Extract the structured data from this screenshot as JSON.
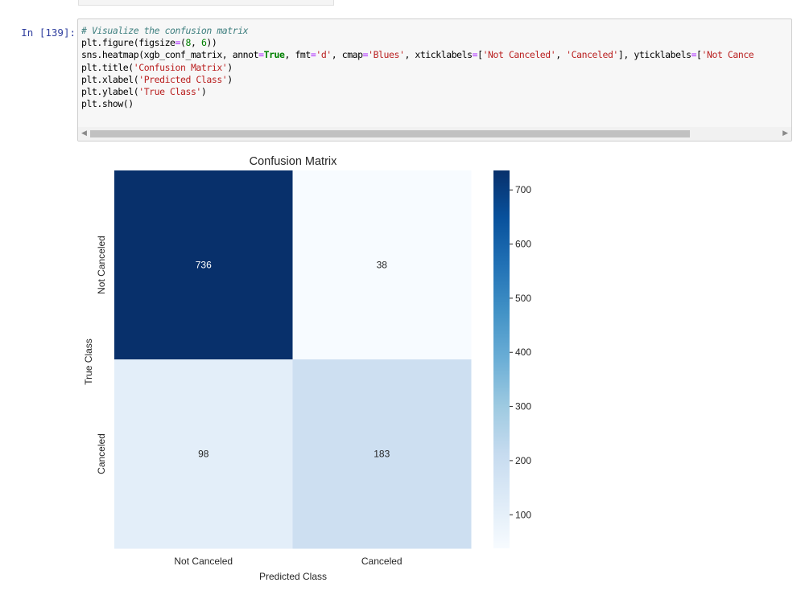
{
  "cell": {
    "prompt": "In [139]:",
    "code_lines": [
      [
        {
          "t": "# Visualize the confusion matrix",
          "c": "cm"
        }
      ],
      [
        {
          "t": "plt.figure(figsize"
        },
        {
          "t": "=",
          "c": "op"
        },
        {
          "t": "("
        },
        {
          "t": "8",
          "c": "nu"
        },
        {
          "t": ", "
        },
        {
          "t": "6",
          "c": "nu"
        },
        {
          "t": "))"
        }
      ],
      [
        {
          "t": "sns.heatmap(xgb_conf_matrix, annot"
        },
        {
          "t": "=",
          "c": "op"
        },
        {
          "t": "True",
          "c": "kw"
        },
        {
          "t": ", fmt"
        },
        {
          "t": "=",
          "c": "op"
        },
        {
          "t": "'d'",
          "c": "st"
        },
        {
          "t": ", cmap"
        },
        {
          "t": "=",
          "c": "op"
        },
        {
          "t": "'Blues'",
          "c": "st"
        },
        {
          "t": ", xticklabels"
        },
        {
          "t": "=",
          "c": "op"
        },
        {
          "t": "["
        },
        {
          "t": "'Not Canceled'",
          "c": "st"
        },
        {
          "t": ", "
        },
        {
          "t": "'Canceled'",
          "c": "st"
        },
        {
          "t": "], yticklabels"
        },
        {
          "t": "=",
          "c": "op"
        },
        {
          "t": "["
        },
        {
          "t": "'Not Cance",
          "c": "st"
        }
      ],
      [
        {
          "t": "plt.title("
        },
        {
          "t": "'Confusion Matrix'",
          "c": "st"
        },
        {
          "t": ")"
        }
      ],
      [
        {
          "t": "plt.xlabel("
        },
        {
          "t": "'Predicted Class'",
          "c": "st"
        },
        {
          "t": ")"
        }
      ],
      [
        {
          "t": "plt.ylabel("
        },
        {
          "t": "'True Class'",
          "c": "st"
        },
        {
          "t": ")"
        }
      ],
      [
        {
          "t": "plt.show()"
        }
      ]
    ],
    "scroll_left_icon": "triangle-left",
    "scroll_right_icon": "triangle-right"
  },
  "chart_data": {
    "type": "heatmap",
    "title": "Confusion Matrix",
    "xlabel": "Predicted Class",
    "ylabel": "True Class",
    "x_categories": [
      "Not Canceled",
      "Canceled"
    ],
    "y_categories": [
      "Not Canceled",
      "Canceled"
    ],
    "values": [
      [
        736,
        38
      ],
      [
        98,
        183
      ]
    ],
    "colormap": "Blues",
    "colorbar": {
      "ticks": [
        100,
        200,
        300,
        400,
        500,
        600,
        700
      ],
      "range": [
        38,
        736
      ]
    },
    "cell_colors": {
      "736": "#08306b",
      "38": "#f7fbff",
      "98": "#e3eef9",
      "183": "#cddff1"
    },
    "annotation_colors": {
      "dark": "#ffffff",
      "light": "#262626"
    }
  }
}
